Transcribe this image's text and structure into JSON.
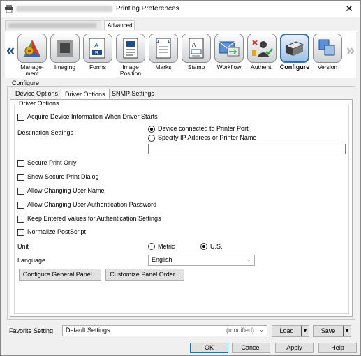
{
  "window": {
    "title": "Printing Preferences",
    "close_glyph": "✕"
  },
  "top_tabs": {
    "advanced": "Advanced"
  },
  "ribbon": {
    "items": [
      {
        "label": "Manage-\nment",
        "icon": "management-icon"
      },
      {
        "label": "Imaging",
        "icon": "imaging-icon"
      },
      {
        "label": "Forms",
        "icon": "forms-icon"
      },
      {
        "label": "Image\nPosition",
        "icon": "image-position-icon"
      },
      {
        "label": "Marks",
        "icon": "marks-icon"
      },
      {
        "label": "Stamp",
        "icon": "stamp-icon"
      },
      {
        "label": "Workflow",
        "icon": "workflow-icon"
      },
      {
        "label": "Authent.",
        "icon": "authentication-icon"
      },
      {
        "label": "Configure",
        "icon": "configure-icon",
        "active": true
      },
      {
        "label": "Version",
        "icon": "version-icon"
      }
    ],
    "left_arrow": "«",
    "right_arrow": "»"
  },
  "configure": {
    "section_label": "Configure",
    "tabs": [
      "Device Options",
      "Driver Options",
      "SNMP Settings"
    ],
    "active_tab": "Driver Options"
  },
  "driver_options": {
    "group_title": "Driver Options",
    "acquire_device_info": {
      "label": "Acquire Device Information When Driver Starts",
      "checked": false
    },
    "destination": {
      "label": "Destination Settings",
      "option_port": "Device connected to Printer Port",
      "option_ip": "Specify IP Address or Printer Name",
      "selected": "port",
      "ip_value": ""
    },
    "checkboxes": [
      {
        "label": "Secure Print Only",
        "checked": false
      },
      {
        "label": "Show Secure Print Dialog",
        "checked": false
      },
      {
        "label": "Allow Changing User Name",
        "checked": false
      },
      {
        "label": "Allow Changing User Authentication Password",
        "checked": false
      },
      {
        "label": "Keep Entered Values for Authentication Settings",
        "checked": false
      },
      {
        "label": "Normalize PostScript",
        "checked": false
      }
    ],
    "unit": {
      "label": "Unit",
      "metric": "Metric",
      "us": "U.S.",
      "selected": "us"
    },
    "language": {
      "label": "Language",
      "value": "English"
    },
    "buttons": {
      "general_panel": "Configure General Panel...",
      "panel_order": "Customize Panel Order..."
    }
  },
  "favorite": {
    "label": "Favorite Setting",
    "value": "Default Settings",
    "modified": "(modified)",
    "load": "Load",
    "save": "Save"
  },
  "dialog_buttons": {
    "ok": "OK",
    "cancel": "Cancel",
    "apply": "Apply",
    "help": "Help"
  }
}
